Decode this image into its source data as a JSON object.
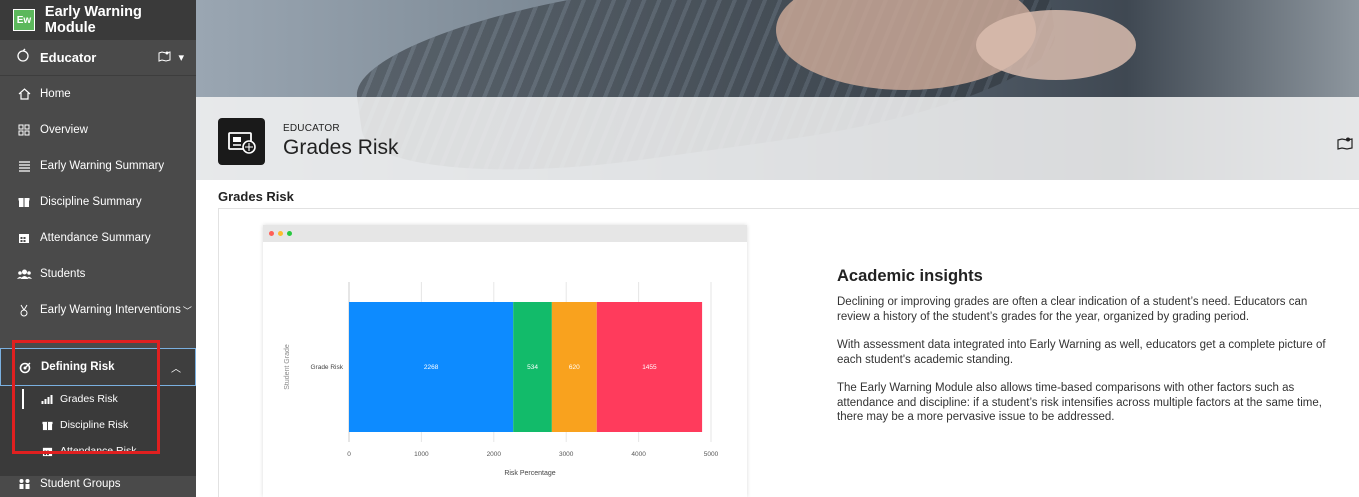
{
  "app": {
    "logo_text": "Ew",
    "title": "Early Warning Module"
  },
  "role": {
    "name": "Educator"
  },
  "sidebar": {
    "items": [
      {
        "label": "Home"
      },
      {
        "label": "Overview"
      },
      {
        "label": "Early Warning Summary"
      },
      {
        "label": "Discipline Summary"
      },
      {
        "label": "Attendance Summary"
      },
      {
        "label": "Students"
      },
      {
        "label": "Early Warning Interventions"
      }
    ],
    "active_group": {
      "label": "Defining Risk",
      "children": [
        {
          "label": "Grades Risk"
        },
        {
          "label": "Discipline Risk"
        },
        {
          "label": "Attendance Risk"
        }
      ]
    },
    "bottom_item": {
      "label": "Student Groups"
    }
  },
  "page": {
    "eyebrow": "EDUCATOR",
    "title": "Grades Risk",
    "section_title": "Grades Risk"
  },
  "chart_data": {
    "type": "bar",
    "orientation": "horizontal",
    "stacked": true,
    "categories": [
      "Grade Risk"
    ],
    "series": [
      {
        "values": [
          2268
        ],
        "color": "#0d8bff"
      },
      {
        "values": [
          534
        ],
        "color": "#12bb6a"
      },
      {
        "values": [
          620
        ],
        "color": "#f9a21e"
      },
      {
        "values": [
          1455
        ],
        "color": "#ff3b5c"
      }
    ],
    "xlabel": "Risk Percentage",
    "ylabel": "Student Grade",
    "xlim": [
      0,
      5000
    ],
    "xticks": [
      "0",
      "1000",
      "2000",
      "3000",
      "4000",
      "5000"
    ],
    "grid": true
  },
  "insights": {
    "title": "Academic insights",
    "paragraphs": [
      "Declining or improving grades are often a clear indication of a student’s need. Educators can review a history of the student’s grades for the year, organized by grading period.",
      "With assessment data integrated into Early Warning as well, educators get a complete picture of each student's academic standing.",
      "The Early Warning Module also allows time-based comparisons with other factors such as attendance and discipline: if a student’s risk intensifies across multiple factors at the same time, there may be a more pervasive issue to be addressed."
    ]
  },
  "colors": {
    "sidebar_bg": "#4a4a4a",
    "highlight": "#e02020",
    "brand_green": "#5cb85c"
  }
}
